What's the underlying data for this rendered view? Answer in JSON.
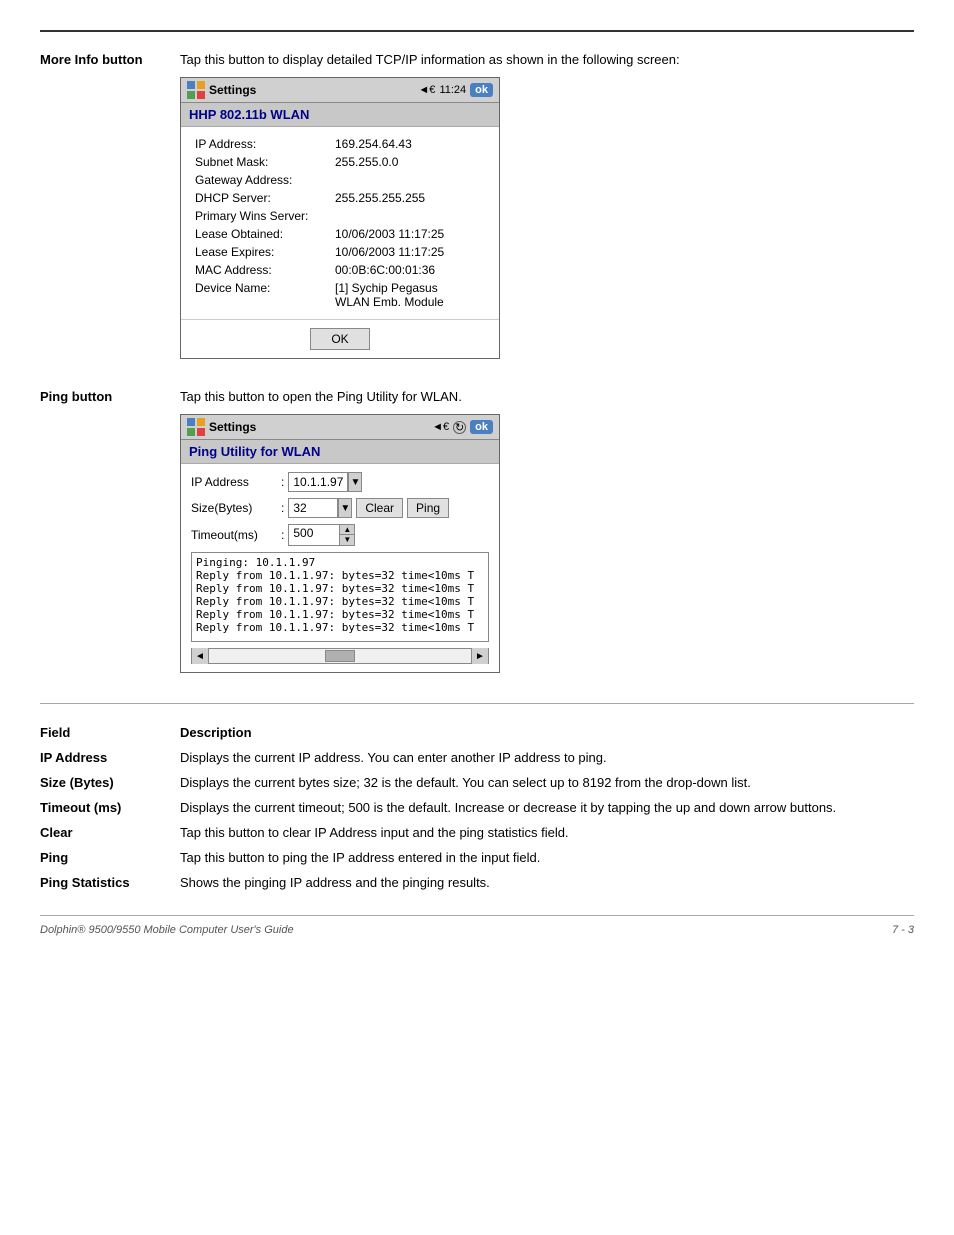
{
  "page": {
    "top_rule": true
  },
  "more_info_section": {
    "label": "More Info button",
    "description": "Tap this button to display detailed TCP/IP information as shown in the following screen:",
    "screen": {
      "header": {
        "title": "Settings",
        "time": "◄€ 11:24",
        "ok_label": "ok"
      },
      "title_bar": "HHP 802.11b WLAN",
      "fields": [
        {
          "label": "IP Address:",
          "value": "169.254.64.43"
        },
        {
          "label": "Subnet Mask:",
          "value": "255.255.0.0"
        },
        {
          "label": "Gateway Address:",
          "value": ""
        },
        {
          "label": "DHCP Server:",
          "value": "255.255.255.255"
        },
        {
          "label": "Primary Wins Server:",
          "value": ""
        },
        {
          "label": "Lease Obtained:",
          "value": "10/06/2003 11:17:25"
        },
        {
          "label": "Lease Expires:",
          "value": "10/06/2003 11:17:25"
        },
        {
          "label": "MAC Address:",
          "value": "00:0B:6C:00:01:36"
        },
        {
          "label": "Device Name:",
          "value": "[1] Sychip Pegasus\nWLAN Emb. Module"
        }
      ],
      "ok_button_label": "OK"
    }
  },
  "ping_section": {
    "label": "Ping button",
    "description": "Tap this button to open the Ping Utility for WLAN.",
    "screen": {
      "header": {
        "title": "Settings",
        "icons": "◄€ ↻",
        "ok_label": "ok"
      },
      "title_bar": "Ping Utility for WLAN",
      "ip_label": "IP Address",
      "ip_value": "10.1.1.97",
      "size_label": "Size(Bytes)",
      "size_value": "32",
      "clear_label": "Clear",
      "ping_label": "Ping",
      "timeout_label": "Timeout(ms)",
      "timeout_value": "500",
      "stats_lines": [
        "Pinging: 10.1.1.97",
        "Reply from 10.1.1.97: bytes=32 time<10ms T",
        "Reply from 10.1.1.97: bytes=32 time<10ms T",
        "Reply from 10.1.1.97: bytes=32 time<10ms T",
        "Reply from 10.1.1.97: bytes=32 time<10ms T",
        "Reply from 10.1.1.97: bytes=32 time<10ms T"
      ]
    }
  },
  "field_table": {
    "col1_header": "Field",
    "col2_header": "Description",
    "rows": [
      {
        "field": "IP Address",
        "description": "Displays the current IP address. You can enter another IP address to ping."
      },
      {
        "field": "Size (Bytes)",
        "description": "Displays the current bytes size; 32 is the default. You can select up to 8192 from the drop-down list."
      },
      {
        "field": "Timeout (ms)",
        "description": "Displays the current timeout; 500 is the default. Increase or decrease it by tapping the up and down arrow buttons."
      },
      {
        "field": "Clear",
        "description": "Tap this button to clear IP Address input and the ping statistics field."
      },
      {
        "field": "Ping",
        "description": "Tap this button to ping the IP address entered in the input field."
      },
      {
        "field": "Ping Statistics",
        "description": "Shows the pinging IP address and the pinging results."
      }
    ]
  },
  "footer": {
    "left": "Dolphin® 9500/9550 Mobile Computer User's Guide",
    "right": "7 - 3"
  }
}
